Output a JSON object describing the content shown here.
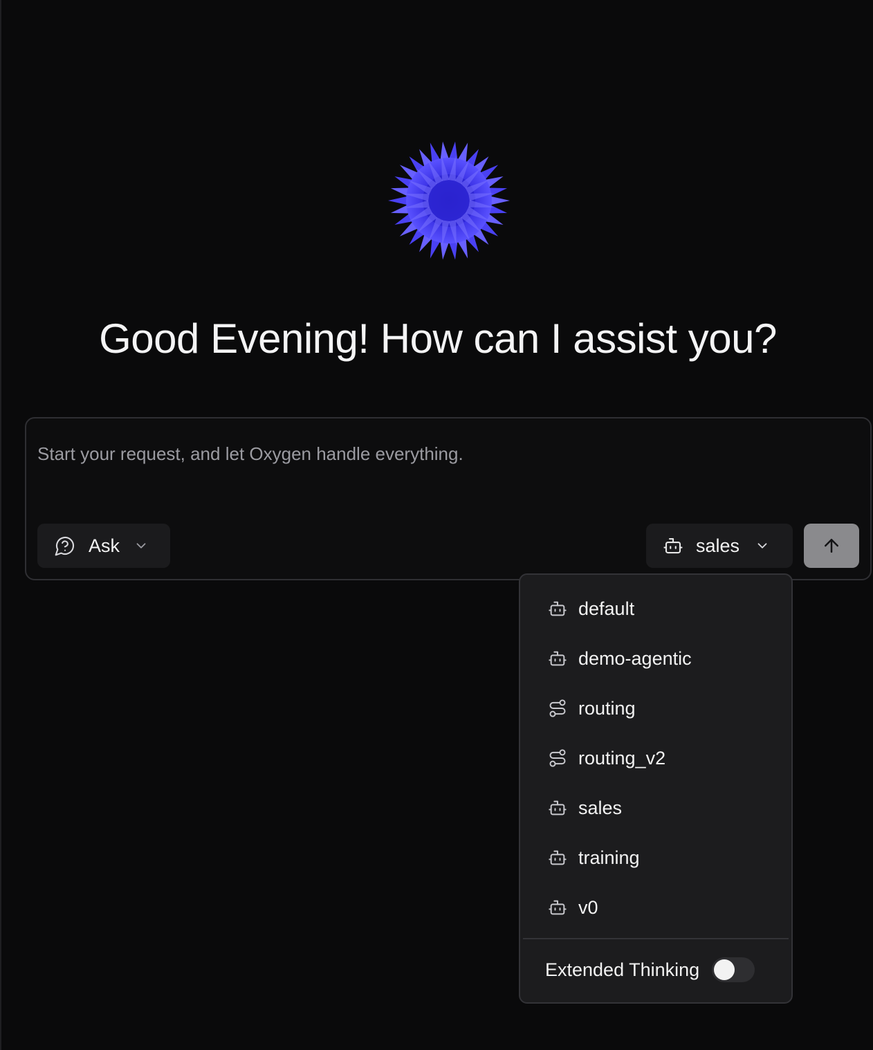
{
  "greeting": "Good Evening! How can I assist you?",
  "composer": {
    "placeholder": "Start your request, and let Oxygen handle everything.",
    "value": ""
  },
  "mode_selector": {
    "label": "Ask",
    "icon": "question-bubble-icon"
  },
  "agent_selector": {
    "label": "sales",
    "icon": "bot-icon"
  },
  "send_button": {
    "icon": "arrow-up-icon"
  },
  "agent_menu": {
    "items": [
      {
        "label": "default",
        "icon": "bot-icon"
      },
      {
        "label": "demo-agentic",
        "icon": "bot-icon"
      },
      {
        "label": "routing",
        "icon": "route-icon"
      },
      {
        "label": "routing_v2",
        "icon": "route-icon"
      },
      {
        "label": "sales",
        "icon": "bot-icon"
      },
      {
        "label": "training",
        "icon": "bot-icon"
      },
      {
        "label": "v0",
        "icon": "bot-icon"
      }
    ],
    "extended_thinking": {
      "label": "Extended Thinking",
      "enabled": false
    }
  },
  "colors": {
    "background": "#0a0a0b",
    "orb": "#3a2fe0",
    "send_button": "#8a8a8d",
    "menu_bg": "#1c1c1e"
  }
}
